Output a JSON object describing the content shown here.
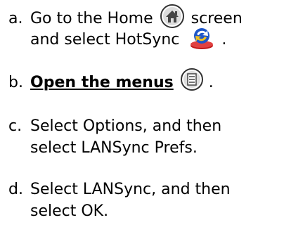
{
  "steps": [
    {
      "marker": "a.",
      "line1_before": "Go to the Home",
      "line1_after": "screen",
      "line2_before": "and select HotSync",
      "line2_after": ".",
      "icons": [
        "home-icon",
        "hotsync-icon"
      ]
    },
    {
      "marker": "b.",
      "link_text": "Open the menus",
      "after": ".",
      "icons": [
        "menu-icon"
      ]
    },
    {
      "marker": "c.",
      "line1": "Select Options, and then",
      "line2": "select LANSync Prefs."
    },
    {
      "marker": "d.",
      "line1": "Select LANSync, and then",
      "line2": "select OK."
    }
  ]
}
